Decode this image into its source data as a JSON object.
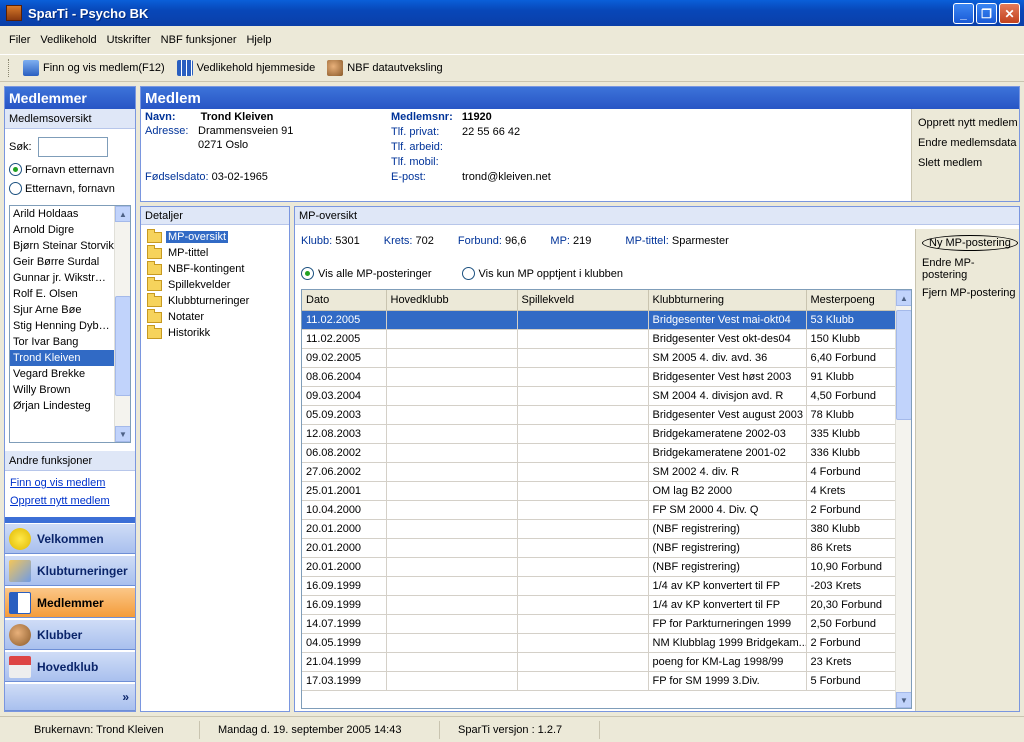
{
  "window": {
    "title": "SparTi - Psycho BK",
    "min": "_",
    "max": "❐",
    "close": "✕"
  },
  "menu": [
    "Filer",
    "Vedlikehold",
    "Utskrifter",
    "NBF funksjoner",
    "Hjelp"
  ],
  "toolbar": {
    "find": "Finn og vis medlem(F12)",
    "home": "Vedlikehold hjemmeside",
    "exchange": "NBF datautveksling"
  },
  "left": {
    "title": "Medlemmer",
    "subtitle": "Medlemsoversikt",
    "search_label": "Søk:",
    "search_value": "",
    "sort_first": "Fornavn etternavn",
    "sort_last": "Etternavn, fornavn",
    "members": [
      "Arild Holdaas",
      "Arnold Digre",
      "Bjørn Steinar Storvik",
      "Geir Børre Surdal",
      "Gunnar jr. Wikstr…",
      "Rolf E. Olsen",
      "Sjur Arne Bøe",
      "Stig Henning Dyb…",
      "Tor Ivar Bang",
      "Trond Kleiven",
      "Vegard Brekke",
      "Willy Brown",
      "Ørjan Lindesteg"
    ],
    "other_title": "Andre funksjoner",
    "link_find": "Finn og vis medlem",
    "link_new": "Opprett nytt medlem",
    "nav": [
      "Velkommen",
      "Klubturneringer",
      "Medlemmer",
      "Klubber",
      "Hovedklub"
    ],
    "nav_more": "»"
  },
  "member": {
    "title": "Medlem",
    "name_label": "Navn:",
    "name": "Trond Kleiven",
    "addr_label": "Adresse:",
    "addr1": "Drammensveien 91",
    "addr2": "0271 Oslo",
    "birth_label": "Fødselsdato:",
    "birth": "03-02-1965",
    "nr_label": "Medlemsnr:",
    "nr": "11920",
    "tp_label": "Tlf. privat:",
    "tp": "22 55 66 42",
    "ta_label": "Tlf. arbeid:",
    "tm_label": "Tlf. mobil:",
    "email_label": "E-post:",
    "email": "trond@kleiven.net",
    "actions": [
      "Opprett nytt medlem",
      "Endre medlemsdata",
      "Slett medlem"
    ]
  },
  "details": {
    "title": "Detaljer",
    "items": [
      "MP-oversikt",
      "MP-tittel",
      "NBF-kontingent",
      "Spillekvelder",
      "Klubbturneringer",
      "Notater",
      "Historikk"
    ]
  },
  "mp": {
    "title": "MP-oversikt",
    "klubb_label": "Klubb:",
    "klubb": "5301",
    "krets_label": "Krets:",
    "krets": "702",
    "forbund_label": "Forbund:",
    "forbund": "96,6",
    "mp_label": "MP:",
    "mp": "219",
    "tittel_label": "MP-tittel:",
    "tittel": "Sparmester",
    "opt_all": "Vis alle MP-posteringer",
    "opt_club": "Vis kun MP opptjent i klubben",
    "columns": [
      "Dato",
      "Hovedklubb",
      "Spillekveld",
      "Klubbturnering",
      "Mesterpoeng"
    ],
    "rows": [
      [
        "11.02.2005",
        "",
        "",
        "Bridgesenter Vest mai-okt04",
        "53 Klubb"
      ],
      [
        "11.02.2005",
        "",
        "",
        "Bridgesenter Vest okt-des04",
        "150 Klubb"
      ],
      [
        "09.02.2005",
        "",
        "",
        "SM 2005 4. div. avd. 36",
        "6,40 Forbund"
      ],
      [
        "08.06.2004",
        "",
        "",
        "Bridgesenter Vest høst 2003",
        "91 Klubb"
      ],
      [
        "09.03.2004",
        "",
        "",
        "SM 2004 4. divisjon avd. R",
        "4,50 Forbund"
      ],
      [
        "05.09.2003",
        "",
        "",
        "Bridgesenter Vest august 2003",
        "78 Klubb"
      ],
      [
        "12.08.2003",
        "",
        "",
        "Bridgekameratene 2002-03",
        "335 Klubb"
      ],
      [
        "06.08.2002",
        "",
        "",
        "Bridgekameratene 2001-02",
        "336 Klubb"
      ],
      [
        "27.06.2002",
        "",
        "",
        "SM 2002 4. div. R",
        "4 Forbund"
      ],
      [
        "25.01.2001",
        "",
        "",
        "OM lag B2 2000",
        "4 Krets"
      ],
      [
        "10.04.2000",
        "",
        "",
        "FP SM 2000 4. Div. Q",
        "2 Forbund"
      ],
      [
        "20.01.2000",
        "",
        "",
        "(NBF registrering)",
        "380 Klubb"
      ],
      [
        "20.01.2000",
        "",
        "",
        "(NBF registrering)",
        "86 Krets"
      ],
      [
        "20.01.2000",
        "",
        "",
        "(NBF registrering)",
        "10,90 Forbund"
      ],
      [
        "16.09.1999",
        "",
        "",
        "1/4 av KP konvertert til FP",
        "-203 Krets"
      ],
      [
        "16.09.1999",
        "",
        "",
        "1/4 av KP konvertert til FP",
        "20,30 Forbund"
      ],
      [
        "14.07.1999",
        "",
        "",
        "FP for  Parkturneringen 1999",
        "2,50 Forbund"
      ],
      [
        "04.05.1999",
        "",
        "",
        "NM Klubblag 1999 Bridgekam...",
        "2 Forbund"
      ],
      [
        "21.04.1999",
        "",
        "",
        " poeng for  KM-Lag 1998/99",
        "23 Krets"
      ],
      [
        "17.03.1999",
        "",
        "",
        " FP for SM 1999 3.Div.",
        "5 Forbund"
      ]
    ],
    "actions": [
      "Ny MP-postering",
      "Endre MP-postering",
      "Fjern MP-postering"
    ]
  },
  "status": {
    "user": "Brukernavn: Trond Kleiven",
    "date": "Mandag d. 19. september 2005 14:43",
    "version": "SparTi versjon : 1.2.7"
  },
  "colors": {
    "accent": "#316ac5",
    "nav_active": "#f49c3a",
    "header": "#2855c5"
  }
}
